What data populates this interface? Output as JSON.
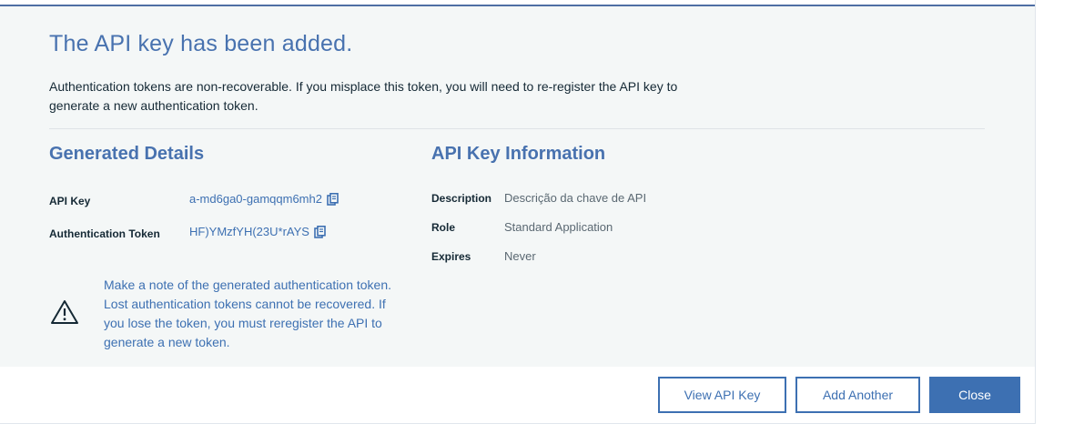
{
  "dialog": {
    "title": "The API key has been added.",
    "subtitle": "Authentication tokens are non-recoverable. If you misplace this token, you will need to re-register the API key to generate a new authentication token."
  },
  "generated": {
    "title": "Generated Details",
    "api_key_label": "API Key",
    "api_key_value": "a-md6ga0-gamqqm6mh2",
    "token_label": "Authentication Token",
    "token_value": "HF)YMzfYH(23U*rAYS",
    "copy_icon": "copy-icon"
  },
  "warning": {
    "icon": "warning-icon",
    "text": "Make a note of the generated authentication token. Lost authentication tokens cannot be recovered. If you lose the token, you must reregister the API to generate a new token."
  },
  "info": {
    "title": "API Key Information",
    "description_label": "Description",
    "description_value": "Descrição da chave de API",
    "role_label": "Role",
    "role_value": "Standard Application",
    "expires_label": "Expires",
    "expires_value": "Never"
  },
  "footer": {
    "view_label": "View API Key",
    "add_label": "Add Another",
    "close_label": "Close"
  },
  "colors": {
    "accent": "#3d70b2",
    "title": "#4872af",
    "body_bg": "#f4f7f7",
    "text": "#152935"
  }
}
